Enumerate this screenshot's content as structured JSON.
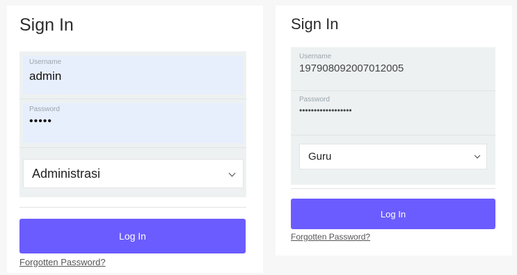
{
  "left": {
    "title": "Sign In",
    "username_label": "Username",
    "username_value": "admin",
    "password_label": "Password",
    "password_value": "•••••",
    "role_selected": "Administrasi",
    "login_label": "Log In",
    "forgot_label": "Forgotten Password?"
  },
  "right": {
    "title": "Sign In",
    "username_label": "Username",
    "username_value": "197908092007012005",
    "password_label": "Password",
    "password_value": "••••••••••••••••••",
    "role_selected": "Guru",
    "login_label": "Log In",
    "forgot_label": "Forgotten Password?"
  },
  "colors": {
    "accent": "#6b5cff",
    "field_bg": "#e8effc",
    "panel_bg": "#eef1f2"
  },
  "icons": {
    "select_chevron": "chevron-down-icon"
  }
}
